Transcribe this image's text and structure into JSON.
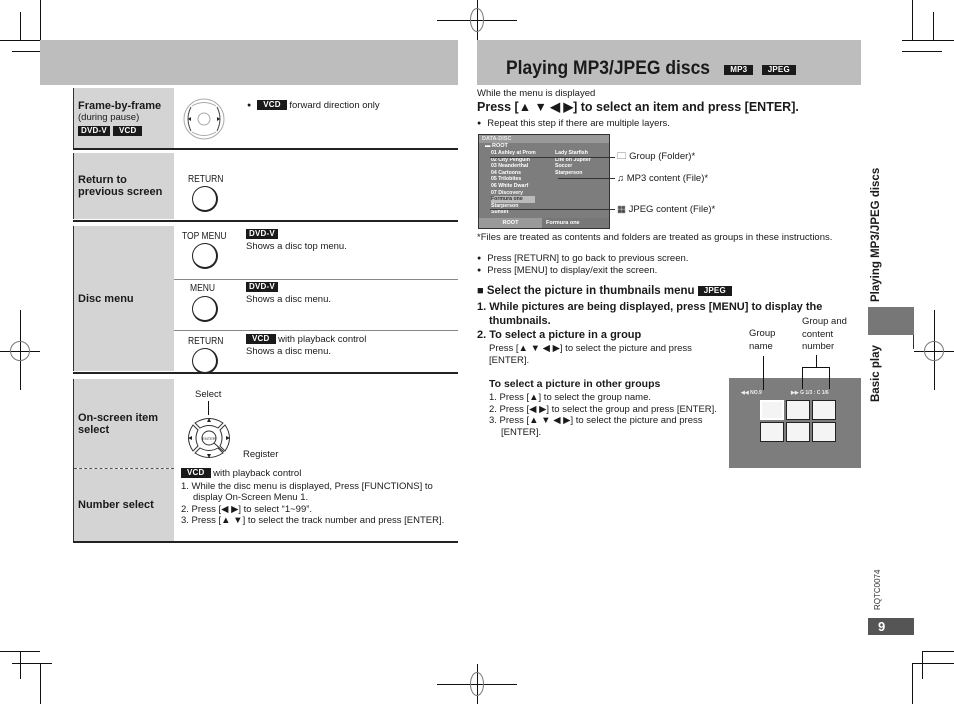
{
  "left_page": {
    "rows": [
      {
        "label": "Frame-by-frame",
        "sublabel": "(during pause)",
        "badges": [
          "DVD-V",
          "VCD"
        ],
        "control_icon": "direction-pad-icon",
        "note_badge": "VCD",
        "note": "forward direction only"
      },
      {
        "label": "Return to previous screen",
        "button_label": "RETURN"
      },
      {
        "label": "Disc menu",
        "entries": [
          {
            "button_label": "TOP MENU",
            "badge": "DVD-V",
            "extra": "",
            "desc": "Shows a disc top menu."
          },
          {
            "button_label": "MENU",
            "badge": "DVD-V",
            "extra": "",
            "desc": "Shows a disc menu."
          },
          {
            "button_label": "RETURN",
            "badge": "VCD",
            "extra": "with playback control",
            "desc": "Shows a disc menu."
          }
        ]
      },
      {
        "label": "On-screen item select",
        "callouts": {
          "select": "Select",
          "register": "Register"
        },
        "enter_label": "ENTER"
      },
      {
        "label": "Number select",
        "badge": "VCD",
        "badge_note": "with playback control",
        "steps": [
          "1. While the disc menu is displayed, Press [FUNCTIONS] to display On-Screen Menu 1.",
          "2. Press [◀ ▶] to select “1~99”.",
          "3. Press [▲ ▼] to select the track number and press [ENTER]."
        ]
      }
    ]
  },
  "right_page": {
    "title": "Playing MP3/JPEG discs",
    "title_badges": [
      "MP3",
      "JPEG"
    ],
    "intro": "While the menu is displayed",
    "instruction": "Press [▲ ▼ ◀ ▶] to select an item and press [ENTER].",
    "repeat_note": "Repeat this step if there are multiple layers.",
    "menu_screen": {
      "header": "DATA-DISC",
      "root": "ROOT",
      "left_items": [
        "01 Ashley at Prom",
        "02 City Penguin",
        "03 Neanderthal",
        "04 Cartoons",
        "05 Trilobites",
        "06 White Dwarf",
        "07 Discovery",
        "Formura one",
        "Starperson",
        "Sunset"
      ],
      "right_items": [
        "Lady Starfish",
        "Life on Jupiter",
        "Soccer",
        "Starperson"
      ],
      "footer_left": "ROOT",
      "footer_right": "Formura one"
    },
    "legend": [
      {
        "icon": "folder-icon",
        "label": "Group (Folder)*"
      },
      {
        "icon": "music-note-icon",
        "label": "MP3 content (File)*"
      },
      {
        "icon": "picture-icon",
        "label": "JPEG content (File)*"
      }
    ],
    "footnote": "*Files are treated as contents and folders are treated as groups in these instructions.",
    "bullets": [
      "Press [RETURN] to go back to previous screen.",
      "Press [MENU] to display/exit the screen."
    ],
    "thumbnail_section": {
      "heading": "Select the picture in thumbnails menu",
      "badge": "JPEG",
      "step1": "1. While pictures are being displayed, press [MENU] to display the thumbnails.",
      "step2_title": "2. To select a picture in a group",
      "step2_text": "Press [▲ ▼ ◀ ▶] to select the picture and press [ENTER].",
      "other_title": "To select a picture in other groups",
      "other_steps": [
        "1. Press [▲] to select the group name.",
        "2. Press [◀ ▶] to select the group and press [ENTER].",
        "3. Press [▲ ▼ ◀ ▶] to select the picture and press [ENTER]."
      ],
      "callout_group_name": "Group name",
      "callout_group_content": "Group and content number",
      "screen_group": "NO.9",
      "screen_numbers": "G 1/3 : C 1/6"
    }
  },
  "side_tab": {
    "section": "Basic play",
    "chapter": "Playing MP3/JPEG discs"
  },
  "footer": {
    "doc_code": "RQTC0074",
    "page_number": "9"
  }
}
